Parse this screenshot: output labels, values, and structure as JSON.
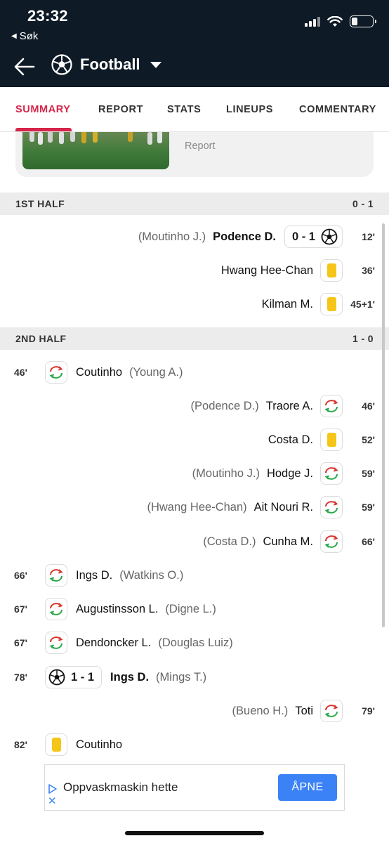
{
  "status_bar": {
    "time": "23:32",
    "back_app": "Søk"
  },
  "nav": {
    "title": "Football"
  },
  "tabs": [
    "SUMMARY",
    "REPORT",
    "STATS",
    "LINEUPS",
    "COMMENTARY"
  ],
  "report_card": {
    "label": "Report"
  },
  "first_half": {
    "label": "1ST HALF",
    "score": "0 - 1",
    "events": [
      {
        "assist": "(Moutinho J.)",
        "player": "Podence D.",
        "score": "0 - 1",
        "minute": "12'"
      },
      {
        "player": "Hwang Hee-Chan",
        "minute": "36'"
      },
      {
        "player": "Kilman M.",
        "minute": "45+1'"
      }
    ]
  },
  "second_half": {
    "label": "2ND HALF",
    "score": "1 - 0",
    "events": [
      {
        "minute": "46'",
        "player": "Coutinho",
        "sub": "(Young A.)"
      },
      {
        "sub": "(Podence D.)",
        "player": "Traore A.",
        "minute": "46'"
      },
      {
        "player": "Costa D.",
        "minute": "52'"
      },
      {
        "sub": "(Moutinho J.)",
        "player": "Hodge J.",
        "minute": "59'"
      },
      {
        "sub": "(Hwang Hee-Chan)",
        "player": "Ait Nouri R.",
        "minute": "59'"
      },
      {
        "sub": "(Costa D.)",
        "player": "Cunha M.",
        "minute": "66'"
      },
      {
        "minute": "66'",
        "player": "Ings D.",
        "sub": "(Watkins O.)"
      },
      {
        "minute": "67'",
        "player": "Augustinsson L.",
        "sub": "(Digne L.)"
      },
      {
        "minute": "67'",
        "player": "Dendoncker L.",
        "sub": "(Douglas Luiz)"
      },
      {
        "minute": "78'",
        "score": "1 - 1",
        "player": "Ings D.",
        "assist": "(Mings T.)"
      },
      {
        "sub": "(Bueno H.)",
        "player": "Toti",
        "minute": "79'"
      },
      {
        "minute": "82'",
        "player": "Coutinho"
      }
    ]
  },
  "ad": {
    "text": "Oppvaskmaskin hette",
    "button": "ÅPNE"
  },
  "colors": {
    "header_bg": "#0e1a26",
    "accent": "#d6244a",
    "yellow_card": "#f5c518",
    "ad_button": "#3b82f6"
  }
}
